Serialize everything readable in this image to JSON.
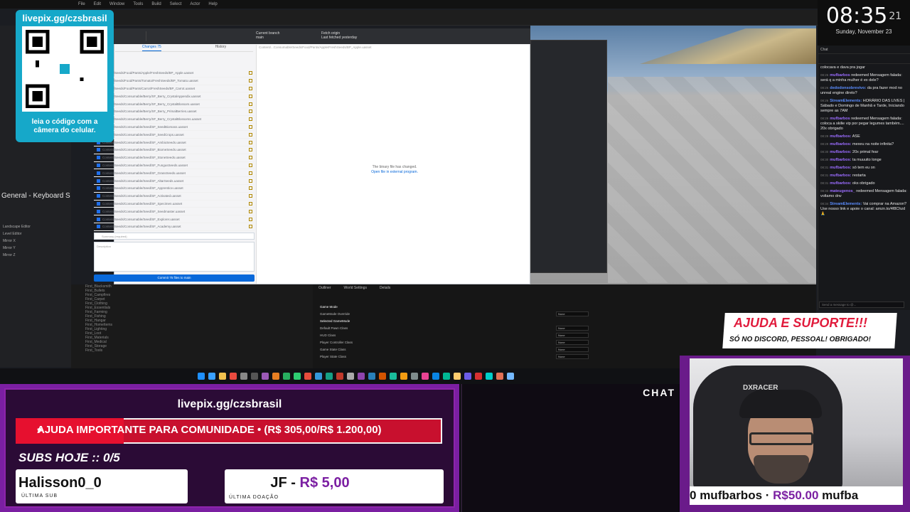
{
  "ue": {
    "menu": [
      "File",
      "Edit",
      "Window",
      "Tools",
      "Build",
      "Select",
      "Actor",
      "Help"
    ],
    "left_panel": [
      "General - Keyboard S",
      "Landscape Editor",
      "Level Editor",
      "Mirror X",
      "Mirror Y",
      "Mirror Z"
    ],
    "content_items": [
      "First_Blacksmith",
      "First_Bullets",
      "First_Campfires",
      "First_Carpet",
      "First_Clothing",
      "First_Essentials",
      "First_Farming",
      "First_Fishing",
      "First_Hangar",
      "First_HomeItems",
      "First_Lighting",
      "First_Loot",
      "First_Materials",
      "First_Medical",
      "First_Storage",
      "First_Tools"
    ],
    "details": {
      "tabs": [
        "Outliner",
        "World Settings",
        "Details"
      ],
      "rows": [
        {
          "label": "Game Mode",
          "value": "",
          "section": true
        },
        {
          "label": "GameMode Override",
          "value": "None",
          "section": false
        },
        {
          "label": "Selected GameMode",
          "value": "",
          "section": true
        },
        {
          "label": "Default Pawn Class",
          "value": "None",
          "section": false
        },
        {
          "label": "HUD Class",
          "value": "None",
          "section": false
        },
        {
          "label": "Player Controller Class",
          "value": "None",
          "section": false
        },
        {
          "label": "Game State Class",
          "value": "None",
          "section": false
        },
        {
          "label": "Player State Class",
          "value": "None",
          "section": false
        }
      ]
    }
  },
  "git": {
    "branch_label": "Current branch",
    "branch": "main",
    "fetch_label": "Fetch origin",
    "fetch_sub": "Last fetched yesterday",
    "tabs": [
      "Changes 75",
      "History"
    ],
    "files": [
      "Content/Seeds/Food/Pants/Apple/FreshSeeds/BP_Apple.uasset",
      "Content/Seeds/Food/Pants/Tomato/FreshSeeds/BP_Tomato.uasset",
      "Content/Seeds/Food/Pants/Carrot/FreshSeeds/BP_Carrot.uasset",
      "Content/Seeds/Consumable/Berry/SF_Berry_CrystalAppendix.uasset",
      "Content/Seeds/Consumable/Berry/SF_Berry_CrystalBlossom.uasset",
      "Content/Seeds/Consumable/Berry/SF_Berry_PrimalBerries.uasset",
      "Content/Seeds/Consumable/Berry/SF_Berry_CrystalBlossoms.uasset",
      "Content/Seeds/Consumable/Seed/SF_SeedBiomass.uasset",
      "Content/Seeds/Consumable/Seed/SF_SeedCrops.uasset",
      "Content/Seeds/Consumable/Seed/SF_AmbioSeeds.uasset",
      "Content/Seeds/Consumable/Seed/SF_BiomeSeeds.uasset",
      "Content/Seeds/Consumable/Seed/SF_StoneSeeds.uasset",
      "Content/Seeds/Consumable/Seed/SF_FungusSeeds.uasset",
      "Content/Seeds/Consumable/Seed/SF_GrassSeeds.uasset",
      "Content/Seeds/Consumable/Seed/SF_AltarSeeds.uasset",
      "Content/Seeds/Consumable/Seed/SF_Apprentice.uasset",
      "Content/Seeds/Consumable/Seed/SF_Activated.uasset",
      "Content/Seeds/Consumable/Seed/SF_Specimen.uasset",
      "Content/Seeds/Consumable/Seed/SF_Seedmaster.uasset",
      "Content/Seeds/Consumable/Seed/SF_Explorer.uasset",
      "Content/Seeds/Consumable/Seed/SF_Academy.uasset"
    ],
    "summary_placeholder": "Summary (required)",
    "description_placeholder": "Description",
    "commit_button": "Commit 75 files to main",
    "diff_path": "Content/...Consumable/Seeds/Food/Pants/Apple/FreshSeeds/BP_Apple.uasset",
    "diff_message": "The binary file has changed.",
    "diff_link": "Open file in external program."
  },
  "clock": {
    "time": "08:35",
    "seconds": "21",
    "date": "Sunday, November 23"
  },
  "chat": {
    "header": "Chat",
    "input_placeholder": "Send a message to @...",
    "messages": [
      {
        "time": "",
        "user": "",
        "text": "colocava e dava pra jogar",
        "color": "#e6e6e6"
      },
      {
        "time": "08:26",
        "user": "mufbarbos",
        "text": "redeemed Mensagem falada: será q a minha mulher é ex dele?",
        "color": "#9b6cff"
      },
      {
        "time": "08:26",
        "user": "dedodonsobrevivo:",
        "text": "da pra fazer mod no unreal engine direto?",
        "color": "#5b8dff"
      },
      {
        "time": "08:26",
        "user": "StreamElements:",
        "text": "HORÁRIO DAS LIVES | Sábado e Domingo de Manhã e Tarde, Iniciando sempre as 7AM",
        "color": "#5b8dff"
      },
      {
        "time": "08:29",
        "user": "mufbarbos",
        "text": "redeemed Mensagem falada: coloca a skilie vip por pegar legumes também.... 20x obrigado",
        "color": "#9b6cff"
      },
      {
        "time": "08:29",
        "user": "mufbarbos:",
        "text": "ASE",
        "color": "#9b6cff"
      },
      {
        "time": "08:29",
        "user": "mufbarbos:",
        "text": "mexeu na noite infinita?",
        "color": "#9b6cff"
      },
      {
        "time": "08:30",
        "user": "mufbarbos:",
        "text": "20x primal fear",
        "color": "#9b6cff"
      },
      {
        "time": "08:30",
        "user": "mufbarbos:",
        "text": "ta muuuito longe",
        "color": "#9b6cff"
      },
      {
        "time": "08:31",
        "user": "mufbarbos:",
        "text": "só tem eu on",
        "color": "#9b6cff"
      },
      {
        "time": "08:31",
        "user": "mufbarbos:",
        "text": "restarta",
        "color": "#9b6cff"
      },
      {
        "time": "08:31",
        "user": "mufbarbos:",
        "text": "oks obrigado",
        "color": "#9b6cff"
      },
      {
        "time": "08:33",
        "user": "mateugenos_",
        "text": "redeemed Mensagem falada: voltamo dnv",
        "color": "#9b6cff"
      },
      {
        "time": "08:34",
        "user": "StreamElements:",
        "text": "Vai comprar na Amazon? Use nosso link e apoie o canal: amzn.to/4f8Chzd 🙏",
        "color": "#5b8dff"
      }
    ]
  },
  "qr": {
    "title": "livepix.gg/czsbrasil",
    "caption": "leia o código com a câmera do celular."
  },
  "support": {
    "title": "AJUDA E SUPORTE!!!",
    "subtitle": "SÓ NO DISCORD, PESSOAL! OBRIGADO!"
  },
  "overlay": {
    "url": "livepix.gg/czsbrasil",
    "goal_text": "AJUDA IMPORTANTE PARA COMUNIDADE  •  (R$ 305,00/R$ 1.200,00)",
    "goal_progress": 0.254,
    "subs_today": "SUBS HOJE :: 0/5",
    "last_sub_name": "Halisson0_0",
    "last_sub_label": "ÚLTIMA SUB",
    "last_donation_user": "JF - ",
    "last_donation_amount": "R$ 5,00",
    "last_donation_label": "ÚLTIMA DOAÇÃO",
    "chat_label": "CHAT",
    "ticker_prefix": "0   ",
    "ticker_user": "mufbarbos  ·  ",
    "ticker_amount": "R$50.00",
    "ticker_suffix": "   mufba"
  },
  "webcam": {
    "chair_brand": "DXRACER"
  },
  "colors": {
    "overlay_purple": "#7b1fa2",
    "goal_red": "#c8102e",
    "qr_teal": "#16a8c9",
    "support_red": "#e11b3c"
  }
}
